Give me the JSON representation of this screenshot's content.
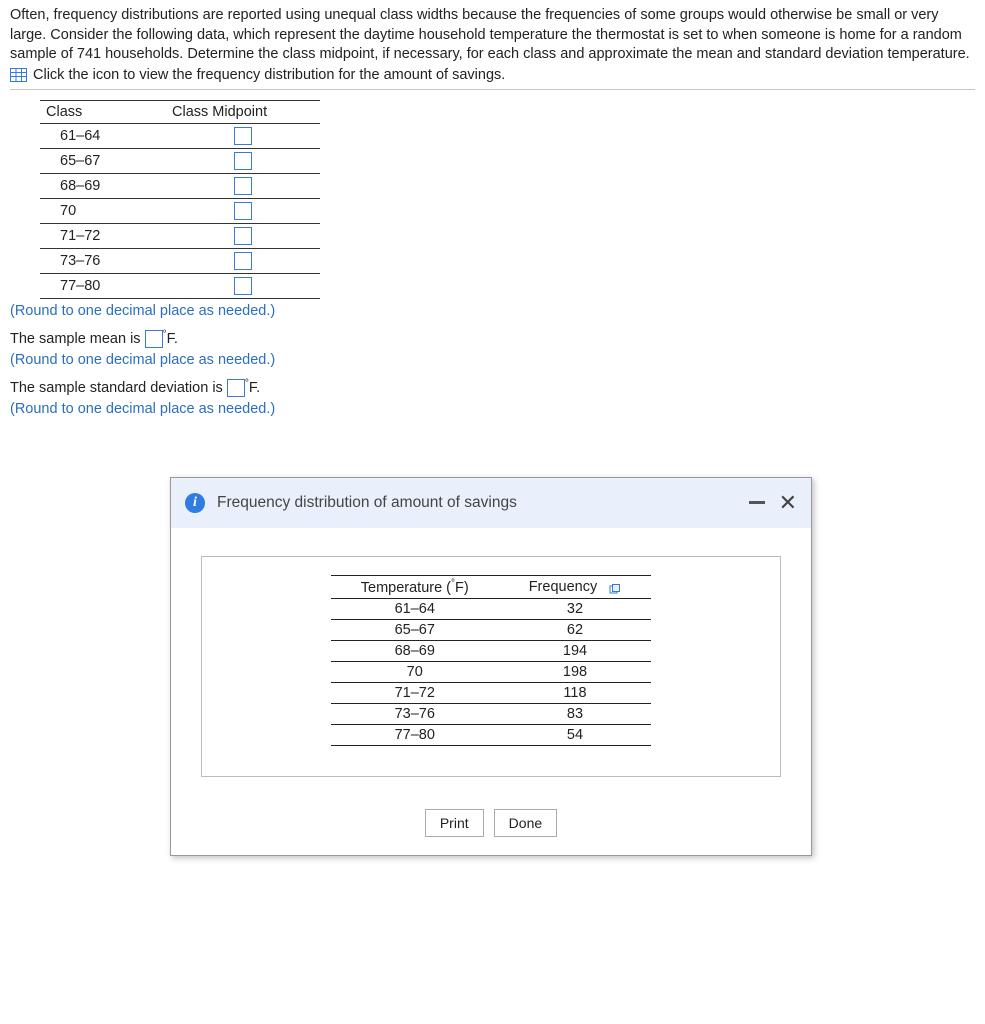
{
  "intro": "Often, frequency distributions are reported using unequal class widths because the frequencies of some groups would otherwise be small or very large. Consider the following data, which represent the daytime household temperature the thermostat is set to when someone is home for a random sample of 741 households. Determine the class midpoint, if necessary, for each class and approximate the mean and standard deviation temperature.",
  "click_text": "Click the icon to view the frequency distribution for the amount of savings.",
  "mid_table": {
    "header_class": "Class",
    "header_mid": "Class Midpoint",
    "rows": [
      "61–64",
      "65–67",
      "68–69",
      "70",
      "71–72",
      "73–76",
      "77–80"
    ]
  },
  "round_hint": "(Round to one decimal place as needed.)",
  "mean_pre": "The sample mean is ",
  "mean_post": "°F.",
  "sd_pre": "The sample standard deviation is ",
  "sd_post": "°F.",
  "dialog": {
    "title": "Frequency distribution of amount of savings",
    "col_temp": "Temperature (°F)",
    "col_freq": "Frequency",
    "rows": [
      {
        "t": "61–64",
        "f": "32"
      },
      {
        "t": "65–67",
        "f": "62"
      },
      {
        "t": "68–69",
        "f": "194"
      },
      {
        "t": "70",
        "f": "198"
      },
      {
        "t": "71–72",
        "f": "118"
      },
      {
        "t": "73–76",
        "f": "83"
      },
      {
        "t": "77–80",
        "f": "54"
      }
    ],
    "print": "Print",
    "done": "Done"
  }
}
